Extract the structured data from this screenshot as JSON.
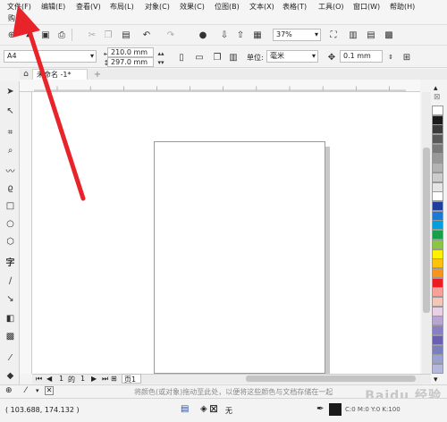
{
  "menubar": {
    "items": [
      "文件(F)",
      "编辑(E)",
      "查看(V)",
      "布局(L)",
      "对象(C)",
      "效果(C)",
      "位图(B)",
      "文本(X)",
      "表格(T)",
      "工具(O)",
      "窗口(W)",
      "帮助(H)"
    ],
    "second_row": "购买"
  },
  "toolbar1": {
    "zoom_value": "37%"
  },
  "toolbar2": {
    "page_size": "A4",
    "width": "210.0 mm",
    "height": "297.0 mm",
    "units_label": "单位:",
    "units_value": "毫米",
    "nudge_value": "0.1 mm"
  },
  "document": {
    "tab_title": "未命名 -1*"
  },
  "page_nav": {
    "current": "1",
    "of_label": "的",
    "total": "1",
    "page_tab": "页1"
  },
  "hint_text": "将颜色(或对象)拖动至此处，以便将这些颜色与文档存储在一起",
  "status": {
    "coords": "( 103.688, 174.132 )",
    "fill_label": "无",
    "outline_info": "C:0 M:0 Y:0 K:100"
  },
  "watermark": "Baidu 经验",
  "palette_colors": [
    "#ffffff",
    "#1a1a1a",
    "#3a3a3a",
    "#5a5a5a",
    "#7a7a7a",
    "#999999",
    "#b3b3b3",
    "#cccccc",
    "#e5e5e5",
    "#ffffff",
    "#1f3f9a",
    "#1a7ad4",
    "#00a0e0",
    "#18a048",
    "#8cc63f",
    "#fff200",
    "#ffc20e",
    "#f7941d",
    "#ed1c24",
    "#f6a19a",
    "#f3c6b5",
    "#e9d0e5",
    "#b7a6d2",
    "#8a7fc4",
    "#6a5fb0",
    "#7c7fbf",
    "#9aa0cf",
    "#b4b8dc"
  ],
  "accent_red": "#e8232a"
}
